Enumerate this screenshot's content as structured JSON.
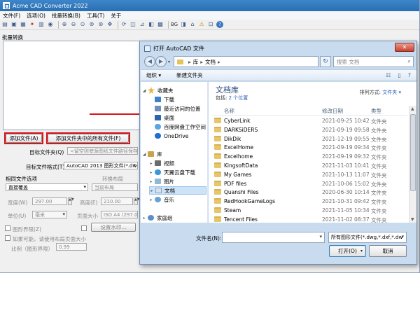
{
  "app": {
    "title": "Acme CAD Converter 2022",
    "menu": [
      "文件(F)",
      "选项(O)",
      "批量转换(B)",
      "工具(T)",
      "关于"
    ],
    "toolbar_text": "BG",
    "batch_label": "批量转换",
    "add_file_btn": "添加文件(A)",
    "add_folder_btn": "添加文件夹中的所有文件(F)",
    "target_folder_label": "目标文件夹(Q)",
    "target_folder_hint": "<留空则使源图纸文件路径保存输",
    "target_format_label": "目标文件格式(T)",
    "target_format_value": "AutoCAD 2013 图形文件(*.dwg,",
    "same_name_label": "相同文件选项",
    "same_name_value": "直接覆盖",
    "convert_layout_label": "转换布局",
    "convert_layout_value": "当前布局",
    "width_label": "宽度(W)",
    "width_value": "297.00",
    "height_label": "高度(E)",
    "height_value": "210.00",
    "unit_label": "单位(U)",
    "unit_value": "毫米",
    "page_size_label": "页面大小",
    "page_size_value": "ISO A4 (297.00",
    "border_label": "图形界限(Z)",
    "watermark_btn": "设置水印...",
    "layout_check_label": "如果可能，请使用布局页面大小",
    "ratio_label": "比例（图形界限）",
    "ratio_value": "0.99"
  },
  "dialog": {
    "title": "打开 AutoCAD 文件",
    "path": [
      "库",
      "文档"
    ],
    "search_placeholder": "搜索 文档",
    "organize": "组织 ▾",
    "new_folder": "新建文件夹",
    "nav": {
      "favorites": "收藏夹",
      "downloads": "下载",
      "recent": "最近访问的位置",
      "desktop": "桌面",
      "baidu": "百度网盘工作空间",
      "onedrive": "OneDrive",
      "library": "库",
      "videos": "视频",
      "tianyi": "天翼云盘下载",
      "pictures": "图片",
      "documents": "文档",
      "music": "音乐",
      "homegroup": "家庭组"
    },
    "library_title": "文档库",
    "library_includes": "包括:",
    "library_locations": "2 个位置",
    "arrange_label": "排列方式:",
    "arrange_value": "文件夹 ▾",
    "columns": {
      "name": "名称",
      "date": "修改日期",
      "type": "类型"
    },
    "files": [
      {
        "name": "CyberLink",
        "date": "2021-09-25 10:42",
        "type": "文件夹"
      },
      {
        "name": "DARKSiDERS",
        "date": "2021-09-19 09:58",
        "type": "文件夹"
      },
      {
        "name": "DikDik",
        "date": "2021-12-19 09:55",
        "type": "文件夹"
      },
      {
        "name": "ExcelHome",
        "date": "2021-09-19 09:34",
        "type": "文件夹"
      },
      {
        "name": "Excelhome",
        "date": "2021-09-19 09:32",
        "type": "文件夹"
      },
      {
        "name": "KingsoftData",
        "date": "2021-11-03 10:41",
        "type": "文件夹"
      },
      {
        "name": "My Games",
        "date": "2021-10-13 11:07",
        "type": "文件夹"
      },
      {
        "name": "PDF files",
        "date": "2021-10-06 15:02",
        "type": "文件夹"
      },
      {
        "name": "Quanshi Files",
        "date": "2020-06-30 10:14",
        "type": "文件夹"
      },
      {
        "name": "RedHookGameLogs",
        "date": "2021-10-31 09:42",
        "type": "文件夹"
      },
      {
        "name": "Steam",
        "date": "2021-11-05 10:34",
        "type": "文件夹"
      },
      {
        "name": "Tencent Files",
        "date": "2021-11-02 08:37",
        "type": "文件夹"
      }
    ],
    "filename_label": "文件名(N):",
    "filename_value": "",
    "filetype_value": "所有图形文件(*.dwg,*.dxf,*.dw",
    "open_btn": "打开(O)",
    "cancel_btn": "取消",
    "accent_color": "#d7141a"
  }
}
